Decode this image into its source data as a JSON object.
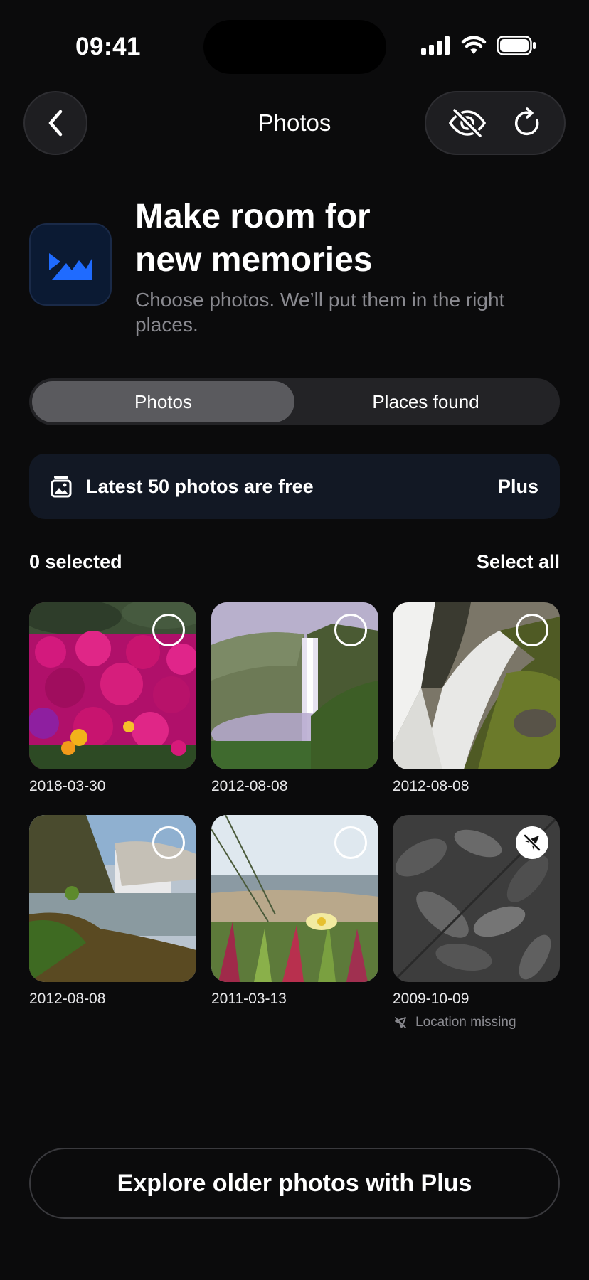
{
  "status_bar": {
    "time": "09:41"
  },
  "nav": {
    "title": "Photos"
  },
  "header": {
    "headline_line1": "Make room for",
    "headline_line2": "new memories",
    "subtext": "Choose photos. We’ll put them in the right places."
  },
  "tabs": [
    {
      "label": "Photos",
      "active": true
    },
    {
      "label": "Places found",
      "active": false
    }
  ],
  "banner": {
    "text": "Latest 50 photos are free",
    "action": "Plus"
  },
  "selection": {
    "count_label": "0 selected",
    "select_all": "Select all"
  },
  "photos": [
    {
      "date": "2018-03-30",
      "subject": "pink flowers"
    },
    {
      "date": "2012-08-08",
      "subject": "waterfall"
    },
    {
      "date": "2012-08-08",
      "subject": "waterfall closeup"
    },
    {
      "date": "2012-08-08",
      "subject": "waterfall landscape"
    },
    {
      "date": "2011-03-13",
      "subject": "beach flower"
    },
    {
      "date": "2009-10-09",
      "subject": "leaves",
      "location_missing": "Location missing"
    }
  ],
  "footer": {
    "button_label": "Explore older photos with Plus"
  },
  "colors": {
    "background": "#0b0b0c",
    "accent": "#1f6bff",
    "banner_bg": "#121824"
  }
}
